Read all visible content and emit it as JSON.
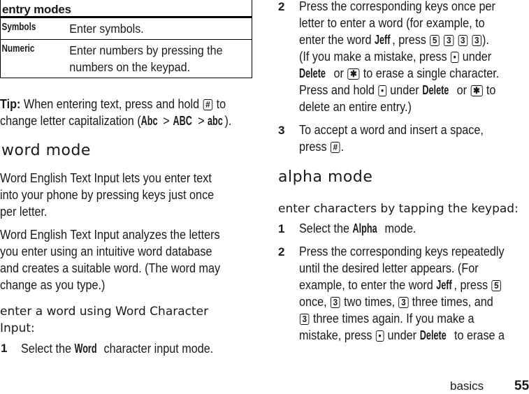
{
  "table": {
    "header": "entry modes",
    "rows": [
      {
        "mode": "Symbols",
        "desc": "Enter symbols."
      },
      {
        "mode": "Numeric",
        "desc_line1": "Enter numbers by pressing the",
        "desc_line2": "numbers on the keypad."
      }
    ]
  },
  "tip": {
    "label": "Tip:",
    "line1_text": " When entering text, press and hold ",
    "key_hash": "#",
    "line1_end": " to",
    "line2_start": "change letter capitalization (",
    "cap1": "Abc",
    "sep1": " > ",
    "cap2": "ABC",
    "sep2": " > ",
    "cap3": "abc",
    "line2_end": ")."
  },
  "word_mode": {
    "heading": "word mode",
    "para1": [
      "Word English Text Input lets you enter text",
      "into your phone by pressing keys just once",
      "per letter."
    ],
    "para2": [
      "Word English Text Input analyzes the letters",
      "you enter using an intuitive word database",
      "and creates a suitable word. (The word may",
      "change as you type.)"
    ],
    "subheading": [
      "enter a word using Word Character",
      "Input:"
    ],
    "step1": {
      "num": "1",
      "pre": "Select the ",
      "bold": "Word",
      "post": " character input mode."
    },
    "step2": {
      "num": "2",
      "l1": "Press the corresponding keys once per",
      "l2": "letter to enter a word (for example, to",
      "l3_pre": "enter the word ",
      "l3_bold": "Jeff",
      "l3_mid": ", press ",
      "keys": [
        "5",
        "3",
        "3",
        "3"
      ],
      "l3_end": ").",
      "l4_pre": "(If you make a mistake, press ",
      "key_dot": "•",
      "l4_end": " under",
      "l5_bold": "Delete",
      "l5_mid": " or ",
      "key_star": "✱",
      "l5_end": " to erase a single character.",
      "l6_pre": "Press and hold ",
      "l6_mid": " under ",
      "l6_bold": "Delete",
      "l6_or": " or ",
      "l6_end": " to",
      "l7": "delete an entire entry.)"
    },
    "step3": {
      "num": "3",
      "l1": "To accept a word and insert a space,",
      "l2_pre": "press ",
      "key": "#",
      "l2_end": "."
    }
  },
  "alpha_mode": {
    "heading": "alpha mode",
    "subheading": "enter characters by tapping the keypad:",
    "step1": {
      "num": "1",
      "pre": "Select the ",
      "bold": "Alpha",
      "post": " mode."
    },
    "step2": {
      "num": "2",
      "l1": "Press the corresponding keys repeatedly",
      "l2": "until the desired letter appears. (For",
      "l3_pre": "example, to enter the word ",
      "l3_bold": "Jeff",
      "l3_mid": ", press ",
      "key5": "5",
      "l4_pre": "once, ",
      "key3": "3",
      "l4_mid1": " two times, ",
      "l4_mid2": " three times, and",
      "l5_end": " three times again. If you make a",
      "l6_pre": "mistake, press ",
      "key_dot": "•",
      "l6_mid": " under ",
      "l6_bold": "Delete",
      "l6_end": " to erase a"
    }
  },
  "footer": {
    "section": "basics",
    "page": "55"
  }
}
